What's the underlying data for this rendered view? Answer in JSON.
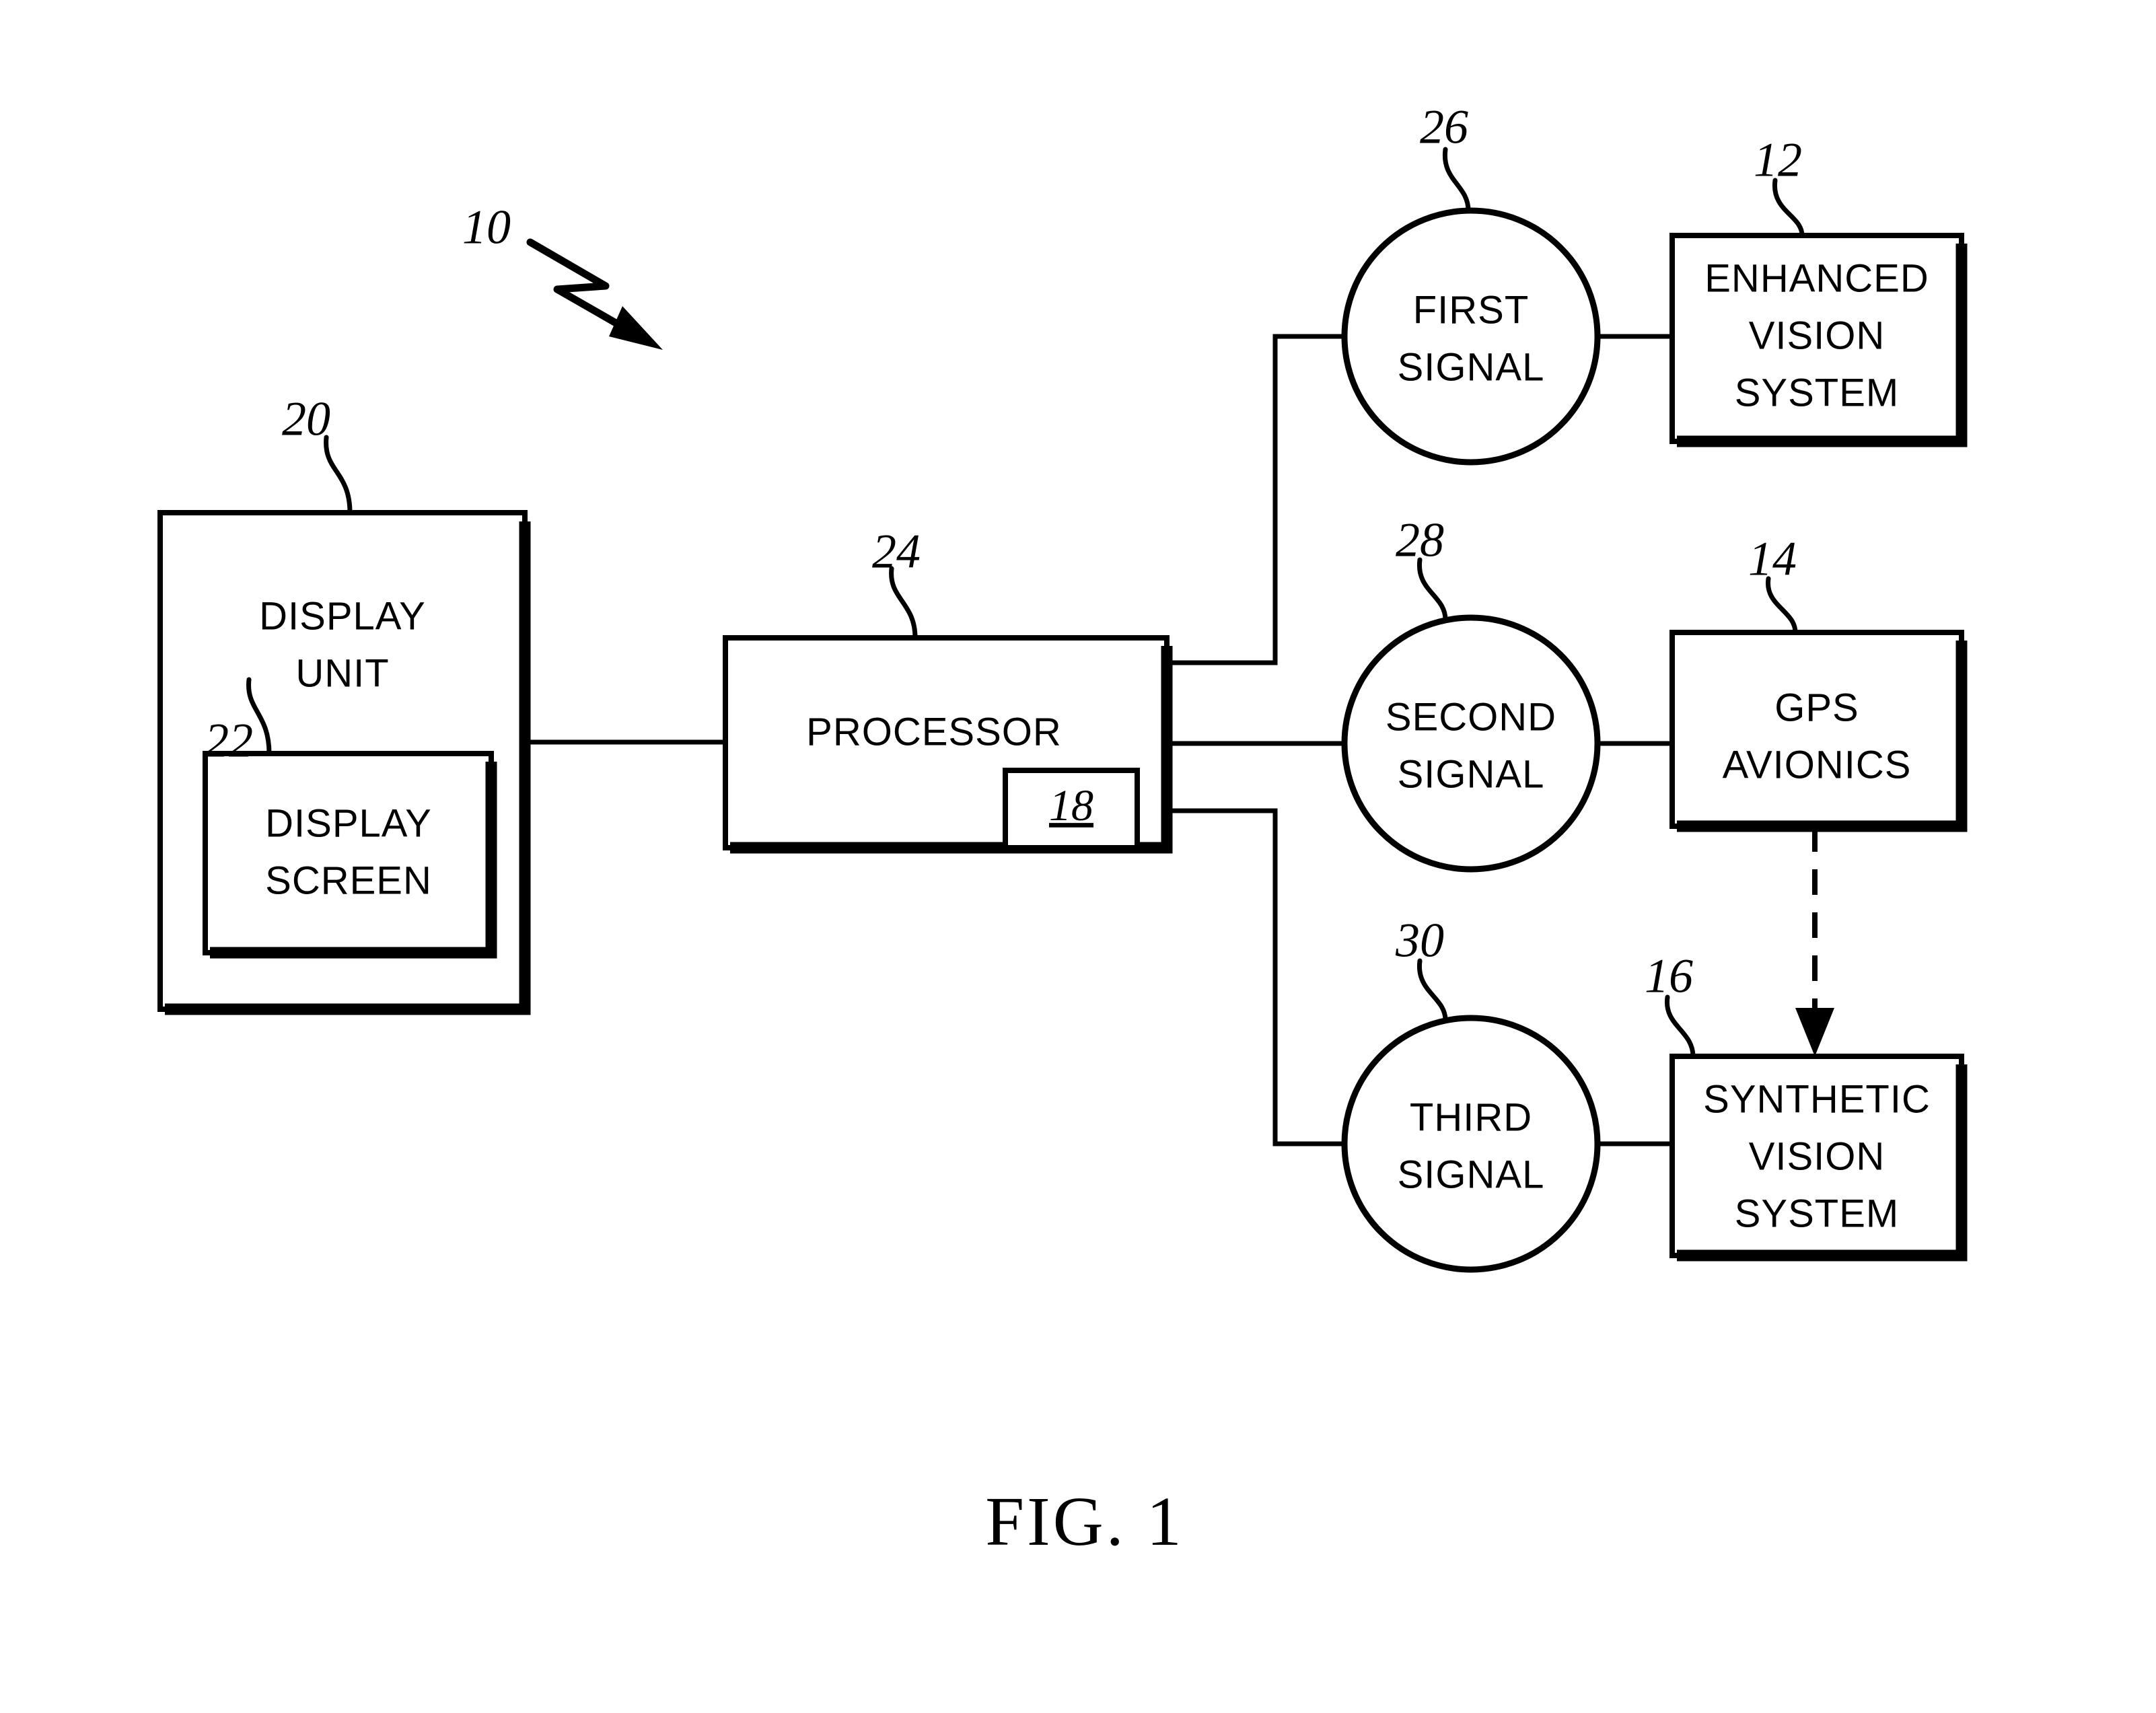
{
  "figure": {
    "caption": "FIG. 1",
    "system_ref": "10"
  },
  "blocks": [
    {
      "id": "display-unit",
      "ref": "20",
      "lines": [
        "DISPLAY",
        "UNIT"
      ]
    },
    {
      "id": "display-screen",
      "ref": "22",
      "lines": [
        "DISPLAY",
        "SCREEN"
      ]
    },
    {
      "id": "processor",
      "ref": "24",
      "lines": [
        "PROCESSOR"
      ],
      "inner_ref": "18"
    },
    {
      "id": "enhanced-vision-system",
      "ref": "12",
      "lines": [
        "ENHANCED",
        "VISION",
        "SYSTEM"
      ]
    },
    {
      "id": "gps-avionics",
      "ref": "14",
      "lines": [
        "GPS",
        "AVIONICS"
      ]
    },
    {
      "id": "synthetic-vision-system",
      "ref": "16",
      "lines": [
        "SYNTHETIC",
        "VISION",
        "SYSTEM"
      ]
    }
  ],
  "signals": [
    {
      "id": "first-signal",
      "ref": "26",
      "lines": [
        "FIRST",
        "SIGNAL"
      ]
    },
    {
      "id": "second-signal",
      "ref": "28",
      "lines": [
        "SECOND",
        "SIGNAL"
      ]
    },
    {
      "id": "third-signal",
      "ref": "30",
      "lines": [
        "THIRD",
        "SIGNAL"
      ]
    }
  ],
  "colors": {
    "ink": "#000000",
    "paper": "#ffffff"
  }
}
